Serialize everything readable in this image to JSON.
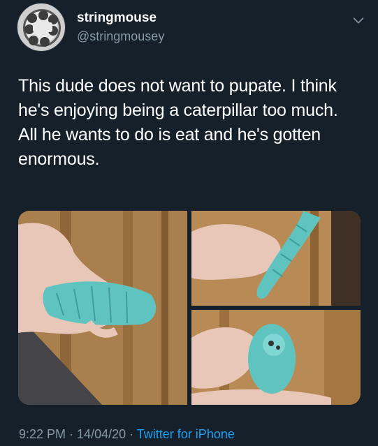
{
  "user": {
    "display_name": "stringmouse",
    "handle": "@stringmousey",
    "avatar_icon": "avatar-photo"
  },
  "tweet": {
    "text": "This dude does not want to pupate. I think he's enjoying being a caterpillar too much. All he wants to do is eat and he's gotten enormous."
  },
  "meta": {
    "time": "9:22 PM",
    "separator": " · ",
    "date": "14/04/20",
    "source": "Twitter for iPhone"
  },
  "media": {
    "count": 3,
    "items": [
      "caterpillar-photo",
      "caterpillar-photo",
      "caterpillar-photo"
    ]
  },
  "colors": {
    "background": "#15202b",
    "text": "#ffffff",
    "muted": "#8899a6",
    "link": "#1da1f2",
    "caterpillar": "#5fc4c0"
  }
}
